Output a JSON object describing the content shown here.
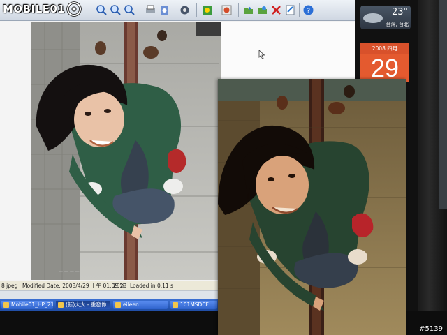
{
  "watermark": {
    "text": "MOBILE01"
  },
  "viewer": {
    "toolbar_icons": [
      "zoom-in-icon",
      "zoom-out-icon",
      "zoom-fit-icon",
      "print-icon",
      "save-icon",
      "rotate-icon",
      "color-icon",
      "slideshow-icon",
      "open-icon",
      "refresh-icon",
      "delete-icon",
      "edit-icon",
      "help-icon"
    ],
    "status": {
      "format": "8 jpeg",
      "modified": "Modified Date: 2008/4/29 上午 01:09:28",
      "zoom": "25%",
      "loaded": "Loaded in 0,11 s"
    }
  },
  "taskbar": {
    "items": [
      {
        "label": "Mobile01_HP_213...",
        "active": false
      },
      {
        "label": "(新)大大 - 重發佈...",
        "active": true
      },
      {
        "label": "eileen",
        "active": false
      },
      {
        "label": "101MSDCF",
        "active": false
      }
    ]
  },
  "desktop": {
    "weather": {
      "temp": "23°",
      "city": "台灣, 台北"
    },
    "calendar": {
      "month": "2008 四月",
      "day": "29"
    }
  },
  "footer": {
    "id": "#5139"
  },
  "colors": {
    "sky": "#4a5766",
    "calendar": "#e45a2f",
    "taskbar": "#2f63cc",
    "jacket": "#2f5e46"
  }
}
